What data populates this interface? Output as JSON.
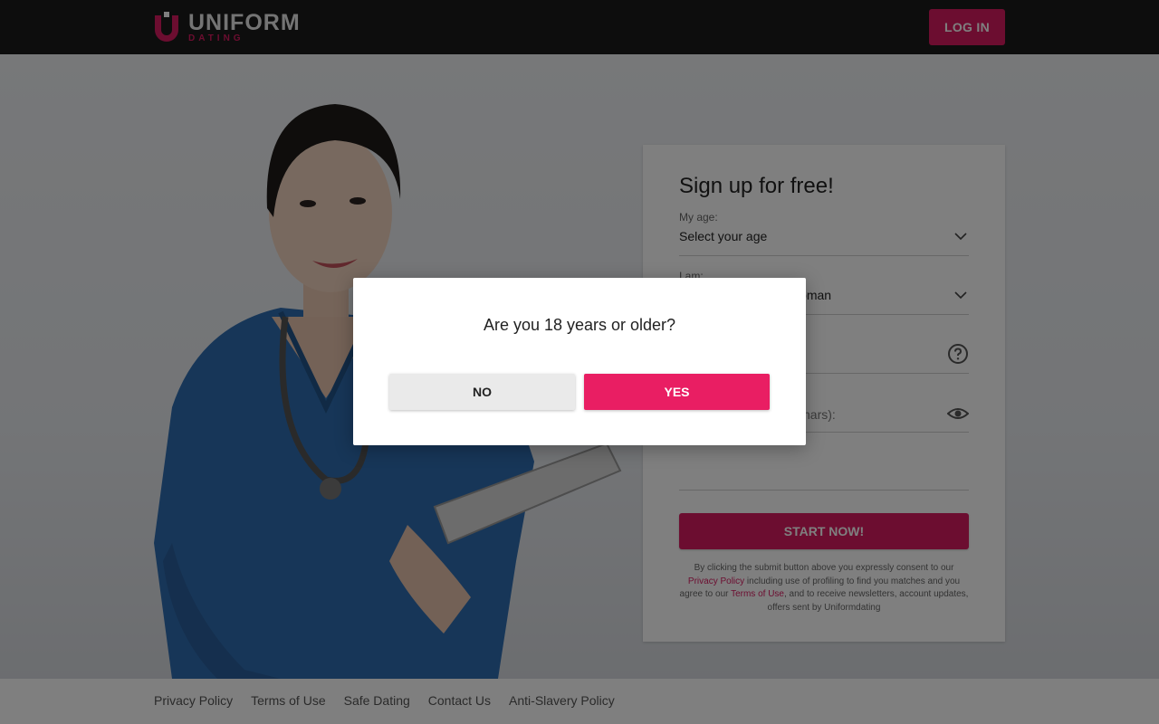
{
  "header": {
    "logo_main": "UNIFORM",
    "logo_sub": "DATING",
    "login_label": "LOG IN"
  },
  "signup": {
    "title": "Sign up for free!",
    "age": {
      "label": "My age:",
      "value": "Select your age"
    },
    "iam": {
      "label": "I am:",
      "value": "a man looking for a woman"
    },
    "password_hint_partial": "chars):",
    "start_label": "START NOW!",
    "consent": {
      "part1": "By clicking the submit button above you expressly consent to our",
      "privacy_link": "Privacy Policy",
      "part2": " including use of profiling to find you matches and you agree to our ",
      "terms_link": "Terms of Use",
      "part3": ", and to receive newsletters, account updates, offers sent by Uniformdating"
    }
  },
  "footer": {
    "links": [
      "Privacy Policy",
      "Terms of Use",
      "Safe Dating",
      "Contact Us",
      "Anti-Slavery Policy"
    ]
  },
  "modal": {
    "question": "Are you 18 years or older?",
    "no_label": "NO",
    "yes_label": "YES"
  },
  "colors": {
    "brand": "#d81b60",
    "yes_button": "#e91e63",
    "header_bg": "#1a1a1a",
    "overlay": "rgba(0,0,0,0.5)"
  },
  "icons": [
    "logo-u-icon",
    "chevron-down-icon",
    "help-circle-icon",
    "eye-icon"
  ]
}
